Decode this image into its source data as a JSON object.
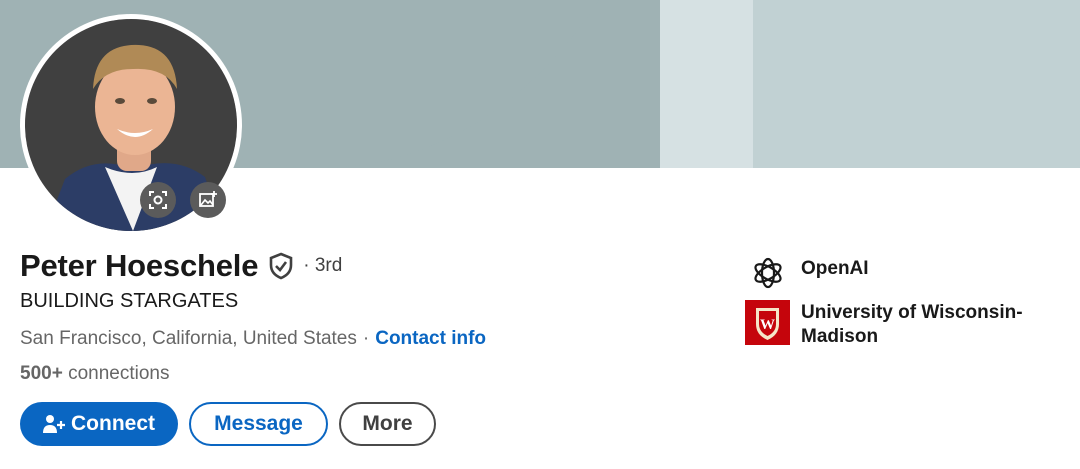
{
  "profile": {
    "name": "Peter Hoeschele",
    "degree": "· 3rd",
    "headline": "BUILDING STARGATES",
    "location": "San Francisco, California, United States",
    "separator": "·",
    "contact_info_label": "Contact info",
    "connections_count": "500+",
    "connections_label": "connections"
  },
  "actions": {
    "connect_label": "Connect",
    "message_label": "Message",
    "more_label": "More"
  },
  "organizations": [
    {
      "name": "OpenAI",
      "icon": "openai-logo"
    },
    {
      "name": "University of Wisconsin-Madison",
      "icon": "uw-madison-crest"
    }
  ],
  "avatar_controls": [
    "face-frame-icon",
    "add-image-icon"
  ],
  "colors": {
    "accent": "#0a66c2",
    "banner": "#9fb2b4",
    "banner_light": "#d6e1e3",
    "uw_red": "#c5050c"
  }
}
